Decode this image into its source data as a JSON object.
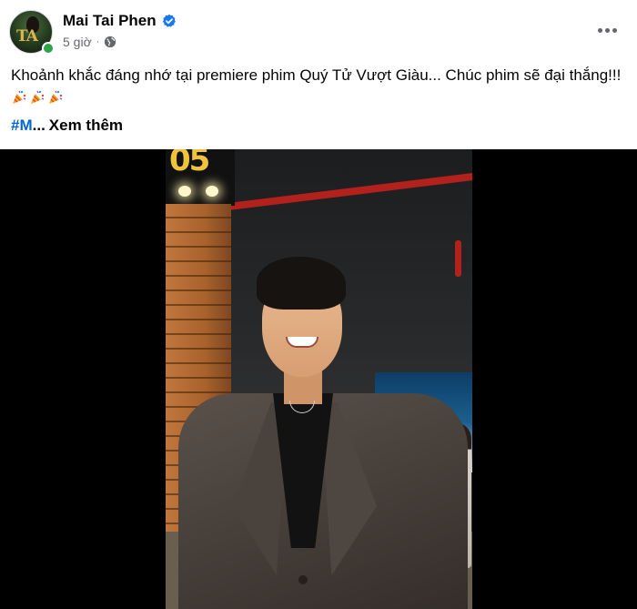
{
  "post": {
    "author": "Mai Tai Phen",
    "avatar_monogram": "TA",
    "time": "5 giờ",
    "privacy_icon": "globe-icon",
    "verified_icon": "verified-badge-icon",
    "more_icon": "more-options-icon",
    "text": "Khoảnh khắc đáng nhớ tại premiere phim Quý Tử Vượt Giàu... Chúc phim sẽ đại thắng!!!",
    "emojis": [
      "party-popper-icon",
      "party-popper-icon",
      "party-popper-icon"
    ],
    "hashtag": "#M",
    "ellipsis": "...",
    "see_more": "Xem thêm"
  },
  "photo": {
    "sign_text": "05"
  },
  "colors": {
    "verified_blue": "#1877f2",
    "link_blue": "#0064d1",
    "online_green": "#31a24c",
    "meta_gray": "#65676b"
  }
}
